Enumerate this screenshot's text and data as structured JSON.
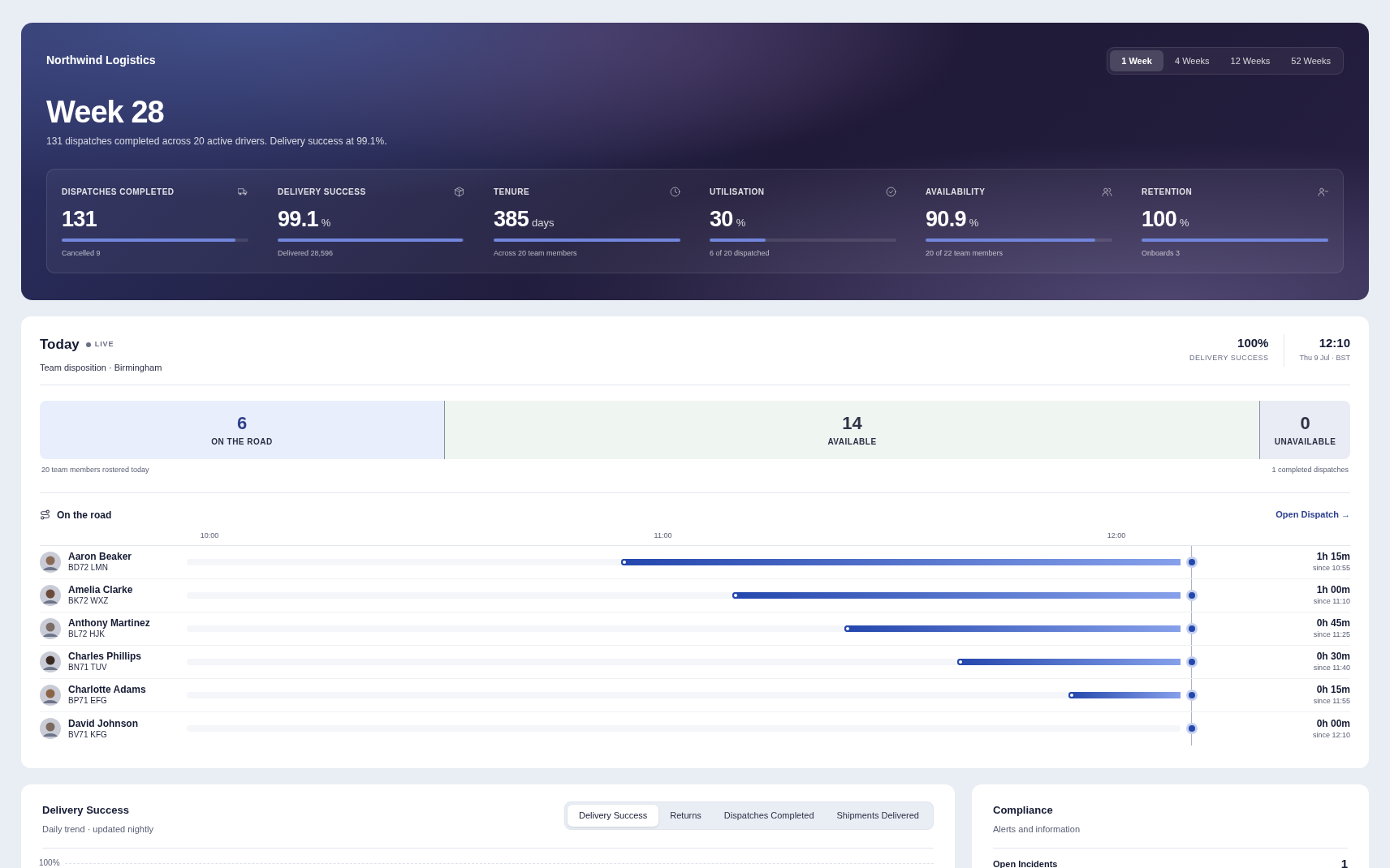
{
  "hero": {
    "brand": "Northwind Logistics",
    "periods": [
      {
        "label": "1 Week",
        "selected": true
      },
      {
        "label": "4 Weeks",
        "selected": false
      },
      {
        "label": "12 Weeks",
        "selected": false
      },
      {
        "label": "52 Weeks",
        "selected": false
      }
    ],
    "title": "Week 28",
    "summary": "131 dispatches completed across 20 active drivers. Delivery success at 99.1%.",
    "stats": [
      {
        "kind": "truck",
        "label": "DISPATCHES COMPLETED",
        "value": "131",
        "level": 0.93,
        "note": "Cancelled 9"
      },
      {
        "kind": "package",
        "label": "DELIVERY SUCCESS",
        "value": "99.1",
        "unit": "%",
        "level": 0.99,
        "note": "Delivered 28,596"
      },
      {
        "kind": "clock",
        "label": "TENURE",
        "value": "385",
        "unit": "days",
        "level": 1,
        "note": "Across 20 team members"
      },
      {
        "kind": "check",
        "label": "UTILISATION",
        "value": "30",
        "unit": "%",
        "level": 0.3,
        "note": "6 of 20 dispatched"
      },
      {
        "kind": "users",
        "label": "AVAILABILITY",
        "value": "90.9",
        "unit": "%",
        "level": 0.909,
        "note": "20 of 22 team members"
      },
      {
        "kind": "user_minus",
        "label": "RETENTION",
        "value": "100",
        "unit": "%",
        "level": 1,
        "note": "Onboards 3"
      }
    ]
  },
  "today": {
    "title": "Today",
    "badge": "LIVE",
    "subtitle": "Team disposition · Birmingham",
    "success_value": "100%",
    "success_label": "DELIVERY SUCCESS",
    "time": "12:10",
    "date": "Thu 9 Jul · BST",
    "segments": [
      {
        "kind": "on_road",
        "count": "6",
        "label": "ON THE ROAD"
      },
      {
        "kind": "available",
        "count": "14",
        "label": "AVAILABLE"
      },
      {
        "kind": "unavailable",
        "count": "0",
        "label": "UNAVAILABLE"
      }
    ],
    "rostered": "20 team members rostered today",
    "completed": "1 completed dispatches",
    "on_road": {
      "title": "On the road",
      "link": "Open Dispatch →",
      "ticks": [
        "10:00",
        "11:00",
        "12:00"
      ],
      "drivers": [
        {
          "name": "Aaron Beaker",
          "plate": "BD72 LMN",
          "level": 0.563,
          "duration": "1h 15m",
          "since": "since 10:55"
        },
        {
          "name": "Amelia Clarke",
          "plate": "BK72 WXZ",
          "level": 0.451,
          "duration": "1h 00m",
          "since": "since 11:10"
        },
        {
          "name": "Anthony Martinez",
          "plate": "BL72 HJK",
          "level": 0.338,
          "duration": "0h 45m",
          "since": "since 11:25"
        },
        {
          "name": "Charles Phillips",
          "plate": "BN71 TUV",
          "level": 0.225,
          "duration": "0h 30m",
          "since": "since 11:40"
        },
        {
          "name": "Charlotte Adams",
          "plate": "BP71 EFG",
          "level": 0.113,
          "duration": "0h 15m",
          "since": "since 11:55"
        },
        {
          "name": "David Johnson",
          "plate": "BV71 KFG",
          "level": 0,
          "duration": "0h 00m",
          "since": "since 12:10"
        }
      ]
    }
  },
  "delivery": {
    "title": "Delivery Success",
    "subtitle": "Daily trend · updated nightly",
    "tabs": [
      {
        "label": "Delivery Success",
        "selected": true
      },
      {
        "label": "Returns",
        "selected": false
      },
      {
        "label": "Dispatches Completed",
        "selected": false
      },
      {
        "label": "Shipments Delivered",
        "selected": false
      }
    ],
    "axis_label": "100%"
  },
  "compliance": {
    "title": "Compliance",
    "subtitle": "Alerts and information",
    "rows": [
      {
        "label": "Open Incidents",
        "value": "1"
      }
    ]
  }
}
